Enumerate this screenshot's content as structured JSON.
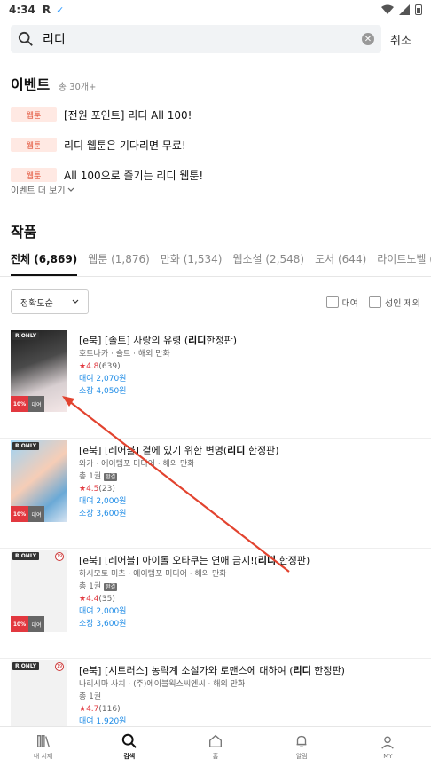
{
  "status": {
    "time": "4:34",
    "app_letter": "R",
    "check": "✓"
  },
  "search": {
    "value": "리디",
    "cancel": "취소"
  },
  "events": {
    "title": "이벤트",
    "count": "총 30개+",
    "items": [
      {
        "badge": "웹툰",
        "text": "[전원 포인트] 리디 All 100!"
      },
      {
        "badge": "웹툰",
        "text": "리디 웹툰은 기다리면 무료!"
      },
      {
        "badge": "웹툰",
        "text": "All 100으로 즐기는 리디 웹툰!"
      }
    ],
    "more": "이벤트 더 보기"
  },
  "works": {
    "title": "작품",
    "tabs": [
      {
        "label": "전체 (6,869)"
      },
      {
        "label": "웹툰 (1,876)"
      },
      {
        "label": "만화 (1,534)"
      },
      {
        "label": "웹소설 (2,548)"
      },
      {
        "label": "도서 (644)"
      },
      {
        "label": "라이트노벨 (217)"
      }
    ],
    "sort": "정확도순",
    "filters": {
      "rent": "대여",
      "adult_exclude": "성인 제외"
    }
  },
  "books": [
    {
      "r_only": "R ONLY",
      "sale": "10%",
      "rent_tag": "대여",
      "title_prefix": "[e북] [솔트] 사랑의 유령 (",
      "title_bold": "리디",
      "title_suffix": "한정판)",
      "meta": "호토나카 · 솔트 · 해외 만화",
      "volume": "",
      "done": "",
      "score": "4.8",
      "reviews": "(639)",
      "rent_price": "대여 2,070원",
      "own_price": "소장 4,050원"
    },
    {
      "r_only": "R ONLY",
      "sale": "10%",
      "rent_tag": "대여",
      "title_prefix": "[e북] [레어블] 곁에 있기 위한 변명(",
      "title_bold": "리디",
      "title_suffix": " 한정판)",
      "meta": "와가 · 에이템포 미디어 · 해외 만화",
      "volume": "총 1권",
      "done": "완결",
      "score": "4.5",
      "reviews": "(23)",
      "rent_price": "대여 2,000원",
      "own_price": "소장 3,600원"
    },
    {
      "r_only": "R ONLY",
      "age": "19",
      "sale": "10%",
      "rent_tag": "대여",
      "title_prefix": "[e북] [레어블] 아이돌 오타쿠는 연애 금지!(",
      "title_bold": "리디",
      "title_suffix": " 한정판)",
      "meta": "하시모토 미츠 · 에이템포 미디어 · 해외 만화",
      "volume": "총 1권",
      "done": "완결",
      "score": "4.4",
      "reviews": "(35)",
      "rent_price": "대여 2,000원",
      "own_price": "소장 3,600원"
    },
    {
      "r_only": "R ONLY",
      "age": "19",
      "sale": "",
      "rent_tag": "",
      "title_prefix": "[e북] [시트러스] 농락계 소설가와 로맨스에 대하여 (",
      "title_bold": "리디",
      "title_suffix": " 한정판)",
      "meta": "나리시마 사치 · (주)에이블웍스씨엔씨 · 해외 만화",
      "volume": "총 1권",
      "done": "",
      "score": "4.7",
      "reviews": "(116)",
      "rent_price": "대여 1,920원",
      "own_price": ""
    }
  ],
  "nav": [
    {
      "label": "내 서재",
      "icon": "library-icon"
    },
    {
      "label": "검색",
      "icon": "search-icon"
    },
    {
      "label": "홈",
      "icon": "home-icon"
    },
    {
      "label": "알림",
      "icon": "bell-icon"
    },
    {
      "label": "MY",
      "icon": "person-icon"
    }
  ],
  "colors": {
    "accent_red": "#e2383f",
    "price_blue": "#1f8ce6",
    "annotation_arrow": "#e2432f"
  }
}
